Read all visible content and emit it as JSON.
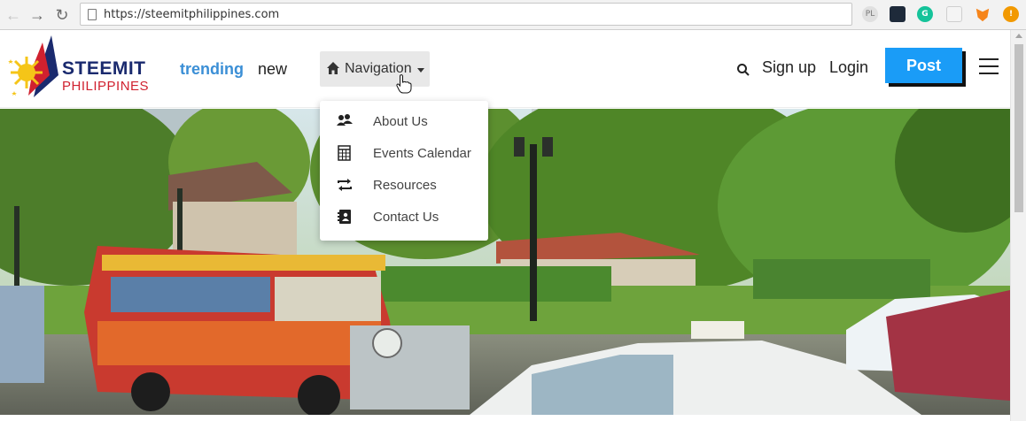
{
  "browser": {
    "url": "https://steemitphilippines.com",
    "extensions": [
      "PL",
      "",
      "G",
      "",
      "",
      "!"
    ]
  },
  "header": {
    "logo": {
      "line1": "STEEMIT",
      "line2": "PHILIPPINES"
    },
    "nav": {
      "trending": "trending",
      "new": "new"
    },
    "navigation_label": "Navigation",
    "signup": "Sign up",
    "login": "Login",
    "post": "Post"
  },
  "dropdown": {
    "items": [
      {
        "label": "About Us",
        "icon": "users-icon"
      },
      {
        "label": "Events Calendar",
        "icon": "calendar-icon"
      },
      {
        "label": "Resources",
        "icon": "retweet-icon"
      },
      {
        "label": "Contact Us",
        "icon": "contact-book-icon"
      }
    ]
  },
  "colors": {
    "accent": "#3b8fd6",
    "post_button": "#1a9cf7",
    "logo_blue": "#1a2a6e",
    "logo_red": "#d0212f"
  },
  "hero": {
    "description_icon": "manila-street-photo"
  }
}
